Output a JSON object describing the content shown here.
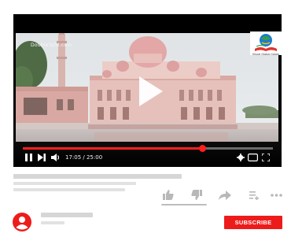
{
  "video": {
    "watermark": "DoubleTafsi.com",
    "channel_logo_caption": "Visual Global Cases"
  },
  "player": {
    "time_display": "17:05 / 25:00",
    "progress": 0.72
  },
  "channel": {
    "subscribe_label": "SUBSCRIBE"
  },
  "colors": {
    "accent": "#ee1b1b",
    "placeholder": "#d6d6d6"
  }
}
